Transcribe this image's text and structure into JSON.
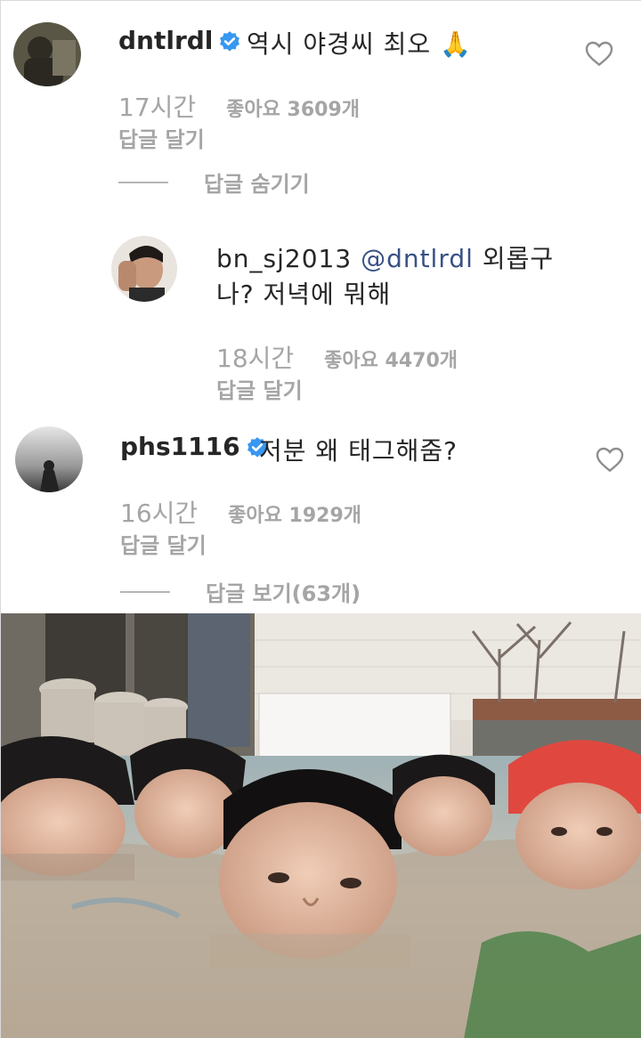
{
  "comments": [
    {
      "username": "dntlrdl",
      "verified": true,
      "text": "역시 야경씨 최오",
      "emoji": "🙏",
      "time": "17시간",
      "likes": "좋아요 3609개",
      "reply_label": "답글 달기",
      "thread_toggle": "답글 숨기기",
      "replies": [
        {
          "username": "bn_sj2013",
          "mention": "@dntlrdl",
          "text_line1": "외롭구",
          "text_line2": "나? 저녁에 뭐해",
          "time": "18시간",
          "likes": "좋아요 4470개",
          "reply_label": "답글 달기"
        }
      ]
    },
    {
      "username": "phs1116",
      "verified": true,
      "text": "저분 왜 태그해줌?",
      "time": "16시간",
      "likes": "좋아요 1929개",
      "reply_label": "답글 달기",
      "thread_toggle": "답글 보기(63개)"
    }
  ],
  "icons": {
    "verified": "verified-badge-icon",
    "like": "heart-icon"
  },
  "colors": {
    "text": "#262626",
    "muted": "#a5a5a5",
    "verified": "#3897f0",
    "mention": "#385185"
  }
}
